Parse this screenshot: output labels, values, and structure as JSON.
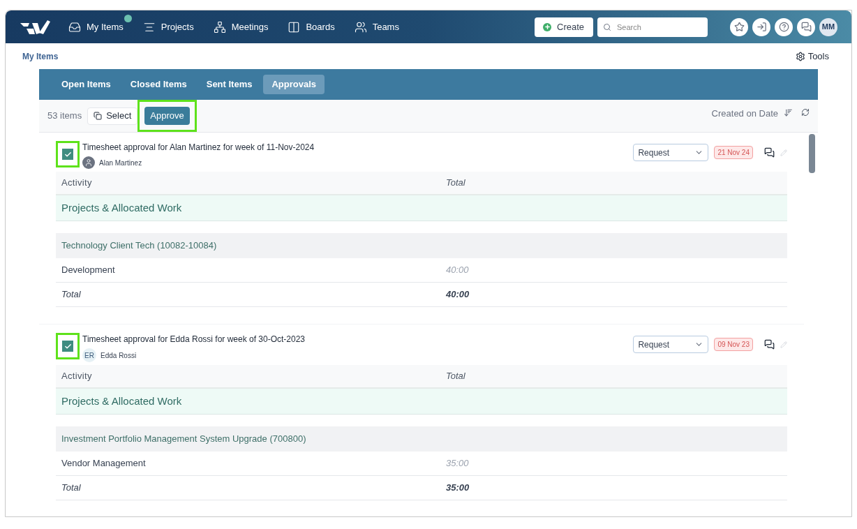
{
  "nav": {
    "items": [
      {
        "label": "My Items",
        "badge": true
      },
      {
        "label": "Projects",
        "badge": false
      },
      {
        "label": "Meetings",
        "badge": false
      },
      {
        "label": "Boards",
        "badge": false
      },
      {
        "label": "Teams",
        "badge": false
      }
    ],
    "create": "Create",
    "search": {
      "placeholder": "Search"
    },
    "avatar": "MM"
  },
  "breadcrumb": "My Items",
  "tools": "Tools",
  "tabs": [
    {
      "label": "Open Items",
      "selected": false
    },
    {
      "label": "Closed Items",
      "selected": false
    },
    {
      "label": "Sent Items",
      "selected": false
    },
    {
      "label": "Approvals",
      "selected": true
    }
  ],
  "toolbar": {
    "count": "53 items",
    "select": "Select",
    "approve": {
      "label": "Approve",
      "highlighted": true
    },
    "sort": "Created on Date"
  },
  "items": [
    {
      "title": "Timesheet approval for Alan Martinez for week of 11-Nov-2024",
      "checked": true,
      "highlighted": true,
      "person": {
        "name": "Alan Martinez"
      },
      "status": "Request",
      "date": "21 Nov 24",
      "columns": [
        "Activity",
        "Total"
      ],
      "section": "Projects & Allocated Work",
      "project": "Technology Client Tech (10082-10084)",
      "rows": [
        {
          "kind": "entry",
          "activity": "Development",
          "total": "40:00"
        },
        {
          "kind": "total",
          "activity": "Total",
          "total": "40:00"
        }
      ]
    },
    {
      "title": "Timesheet approval for Edda Rossi for week of 30-Oct-2023",
      "checked": true,
      "highlighted": true,
      "person": {
        "name": "Edda Rossi",
        "initials": "ER"
      },
      "status": "Request",
      "date": "09 Nov 23",
      "columns": [
        "Activity",
        "Total"
      ],
      "section": "Projects & Allocated Work",
      "project": "Investment Portfolio Management System Upgrade (700800)",
      "rows": [
        {
          "kind": "entry",
          "activity": "Vendor Management",
          "total": "35:00"
        },
        {
          "kind": "total",
          "activity": "Total",
          "total": "35:00"
        }
      ]
    }
  ]
}
